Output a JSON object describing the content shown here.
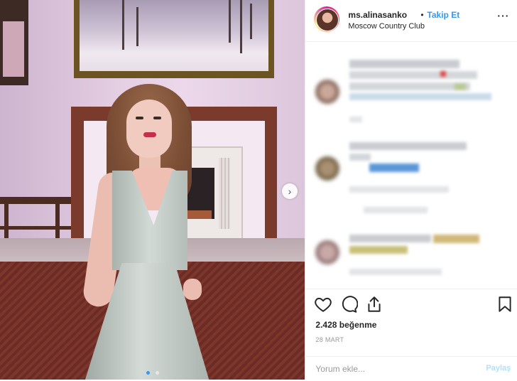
{
  "post": {
    "username": "ms.alinasanko",
    "separator": "•",
    "follow_label": "Takip Et",
    "location": "Moscow Country Club",
    "more_options_icon": "more-options-icon",
    "likes_text": "2.428 beğenme",
    "date_text": "28 MART",
    "comment_placeholder": "Yorum ekle...",
    "share_label": "Paylaş",
    "carousel_next_icon": "chevron-right-icon",
    "carousel": {
      "slides": 2,
      "active_index": 0
    }
  },
  "actions": {
    "like_icon": "heart-icon",
    "comment_icon": "comment-icon",
    "share_icon": "share-icon",
    "save_icon": "bookmark-icon"
  },
  "colors": {
    "accent": "#3897f0",
    "text": "#262626",
    "muted": "#999999",
    "share_disabled": "#b2dffc"
  }
}
